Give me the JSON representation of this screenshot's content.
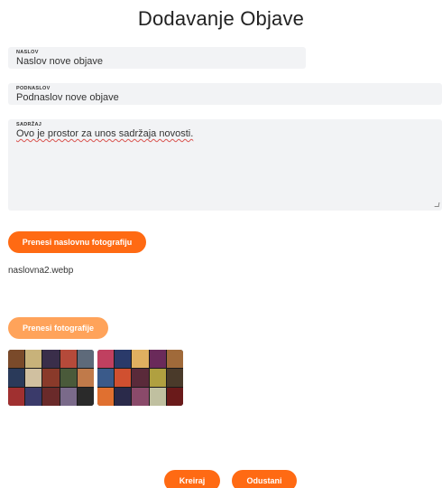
{
  "page": {
    "title": "Dodavanje Objave"
  },
  "form": {
    "naslov": {
      "label": "NASLOV",
      "value": "Naslov nove objave"
    },
    "podnaslov": {
      "label": "PODNASLOV",
      "value": "Podnaslov nove objave"
    },
    "sadrzaj": {
      "label": "SADRŽAJ",
      "value": "Ovo je prostor za unos sadržaja novosti."
    }
  },
  "cover": {
    "button_label": "Prenesi naslovnu fotografiju",
    "filename": "naslovna2.webp"
  },
  "gallery": {
    "button_label": "Prenesi fotografije",
    "thumbnails": [
      {
        "colors": [
          "#7a4a2a",
          "#c8b27a",
          "#3a2e4a",
          "#b54a3a",
          "#5e6a7a",
          "#2a3a5a",
          "#d0c0a0",
          "#8a3a2a",
          "#4a5a3a",
          "#c07a4a",
          "#a03030",
          "#3a3a6a",
          "#6a2a2a",
          "#7a6a8a",
          "#2a2a2a"
        ]
      },
      {
        "colors": [
          "#c04060",
          "#2a3a6a",
          "#e0b060",
          "#6a2a5a",
          "#a06a3a",
          "#3a5a8a",
          "#d05030",
          "#5a2a3a",
          "#b0a040",
          "#4a3a2a",
          "#e07030",
          "#2a2a4a",
          "#8a4a6a",
          "#c0c0a0",
          "#6a1a1a"
        ]
      }
    ]
  },
  "actions": {
    "create_label": "Kreiraj",
    "cancel_label": "Odustani"
  },
  "colors": {
    "accent": "#ff6a13",
    "accent_light": "#ffa35a",
    "field_bg": "#f2f3f5"
  }
}
